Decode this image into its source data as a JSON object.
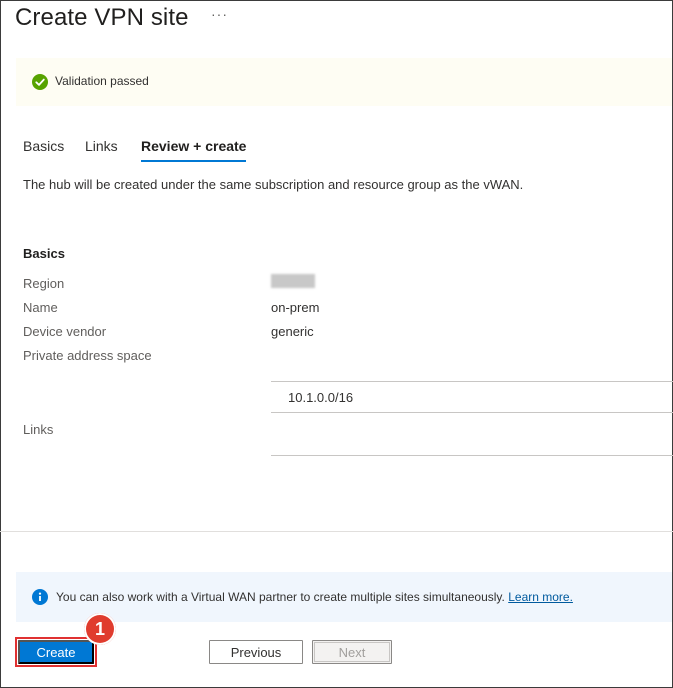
{
  "header": {
    "title": "Create VPN site",
    "more_label": "···"
  },
  "validation": {
    "message": "Validation passed",
    "icon": "check-circle-icon",
    "color": "#57a300"
  },
  "tabs": [
    {
      "label": "Basics",
      "active": false
    },
    {
      "label": "Links",
      "active": false
    },
    {
      "label": "Review + create",
      "active": true
    }
  ],
  "hub_note": "The hub will be created under the same subscription and resource group as the vWAN.",
  "basics": {
    "heading": "Basics",
    "rows": [
      {
        "label": "Region",
        "value": ""
      },
      {
        "label": "Name",
        "value": "on-prem"
      },
      {
        "label": "Device vendor",
        "value": "generic"
      },
      {
        "label": "Private address space",
        "value": ""
      }
    ],
    "address_space": [
      "10.1.0.0/16"
    ],
    "links_label": "Links"
  },
  "info": {
    "icon": "info-icon",
    "text": "You can also work with a Virtual WAN partner to create multiple sites simultaneously.",
    "link": "Learn more."
  },
  "footer": {
    "create_label": "Create",
    "previous_label": "Previous",
    "next_label": "Next"
  },
  "callout": {
    "number": "1",
    "color": "#e03c2e"
  },
  "colors": {
    "accent": "#0078d4",
    "highlight": "#e03131"
  }
}
